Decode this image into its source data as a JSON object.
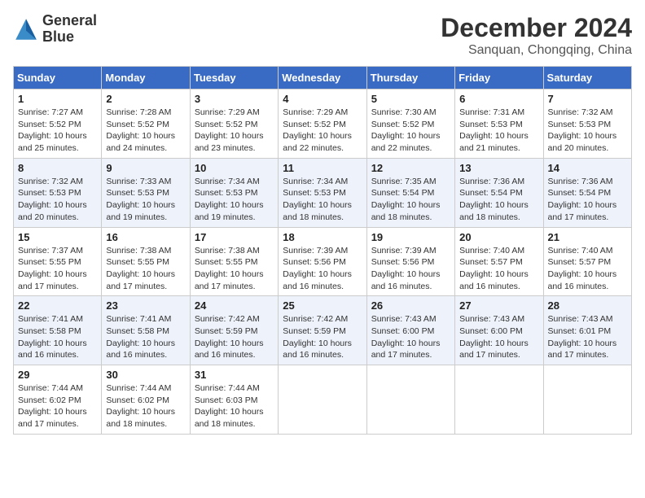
{
  "logo": {
    "line1": "General",
    "line2": "Blue"
  },
  "title": "December 2024",
  "location": "Sanquan, Chongqing, China",
  "weekdays": [
    "Sunday",
    "Monday",
    "Tuesday",
    "Wednesday",
    "Thursday",
    "Friday",
    "Saturday"
  ],
  "weeks": [
    [
      {
        "day": "1",
        "info": "Sunrise: 7:27 AM\nSunset: 5:52 PM\nDaylight: 10 hours\nand 25 minutes."
      },
      {
        "day": "2",
        "info": "Sunrise: 7:28 AM\nSunset: 5:52 PM\nDaylight: 10 hours\nand 24 minutes."
      },
      {
        "day": "3",
        "info": "Sunrise: 7:29 AM\nSunset: 5:52 PM\nDaylight: 10 hours\nand 23 minutes."
      },
      {
        "day": "4",
        "info": "Sunrise: 7:29 AM\nSunset: 5:52 PM\nDaylight: 10 hours\nand 22 minutes."
      },
      {
        "day": "5",
        "info": "Sunrise: 7:30 AM\nSunset: 5:52 PM\nDaylight: 10 hours\nand 22 minutes."
      },
      {
        "day": "6",
        "info": "Sunrise: 7:31 AM\nSunset: 5:53 PM\nDaylight: 10 hours\nand 21 minutes."
      },
      {
        "day": "7",
        "info": "Sunrise: 7:32 AM\nSunset: 5:53 PM\nDaylight: 10 hours\nand 20 minutes."
      }
    ],
    [
      {
        "day": "8",
        "info": "Sunrise: 7:32 AM\nSunset: 5:53 PM\nDaylight: 10 hours\nand 20 minutes."
      },
      {
        "day": "9",
        "info": "Sunrise: 7:33 AM\nSunset: 5:53 PM\nDaylight: 10 hours\nand 19 minutes."
      },
      {
        "day": "10",
        "info": "Sunrise: 7:34 AM\nSunset: 5:53 PM\nDaylight: 10 hours\nand 19 minutes."
      },
      {
        "day": "11",
        "info": "Sunrise: 7:34 AM\nSunset: 5:53 PM\nDaylight: 10 hours\nand 18 minutes."
      },
      {
        "day": "12",
        "info": "Sunrise: 7:35 AM\nSunset: 5:54 PM\nDaylight: 10 hours\nand 18 minutes."
      },
      {
        "day": "13",
        "info": "Sunrise: 7:36 AM\nSunset: 5:54 PM\nDaylight: 10 hours\nand 18 minutes."
      },
      {
        "day": "14",
        "info": "Sunrise: 7:36 AM\nSunset: 5:54 PM\nDaylight: 10 hours\nand 17 minutes."
      }
    ],
    [
      {
        "day": "15",
        "info": "Sunrise: 7:37 AM\nSunset: 5:55 PM\nDaylight: 10 hours\nand 17 minutes."
      },
      {
        "day": "16",
        "info": "Sunrise: 7:38 AM\nSunset: 5:55 PM\nDaylight: 10 hours\nand 17 minutes."
      },
      {
        "day": "17",
        "info": "Sunrise: 7:38 AM\nSunset: 5:55 PM\nDaylight: 10 hours\nand 17 minutes."
      },
      {
        "day": "18",
        "info": "Sunrise: 7:39 AM\nSunset: 5:56 PM\nDaylight: 10 hours\nand 16 minutes."
      },
      {
        "day": "19",
        "info": "Sunrise: 7:39 AM\nSunset: 5:56 PM\nDaylight: 10 hours\nand 16 minutes."
      },
      {
        "day": "20",
        "info": "Sunrise: 7:40 AM\nSunset: 5:57 PM\nDaylight: 10 hours\nand 16 minutes."
      },
      {
        "day": "21",
        "info": "Sunrise: 7:40 AM\nSunset: 5:57 PM\nDaylight: 10 hours\nand 16 minutes."
      }
    ],
    [
      {
        "day": "22",
        "info": "Sunrise: 7:41 AM\nSunset: 5:58 PM\nDaylight: 10 hours\nand 16 minutes."
      },
      {
        "day": "23",
        "info": "Sunrise: 7:41 AM\nSunset: 5:58 PM\nDaylight: 10 hours\nand 16 minutes."
      },
      {
        "day": "24",
        "info": "Sunrise: 7:42 AM\nSunset: 5:59 PM\nDaylight: 10 hours\nand 16 minutes."
      },
      {
        "day": "25",
        "info": "Sunrise: 7:42 AM\nSunset: 5:59 PM\nDaylight: 10 hours\nand 16 minutes."
      },
      {
        "day": "26",
        "info": "Sunrise: 7:43 AM\nSunset: 6:00 PM\nDaylight: 10 hours\nand 17 minutes."
      },
      {
        "day": "27",
        "info": "Sunrise: 7:43 AM\nSunset: 6:00 PM\nDaylight: 10 hours\nand 17 minutes."
      },
      {
        "day": "28",
        "info": "Sunrise: 7:43 AM\nSunset: 6:01 PM\nDaylight: 10 hours\nand 17 minutes."
      }
    ],
    [
      {
        "day": "29",
        "info": "Sunrise: 7:44 AM\nSunset: 6:02 PM\nDaylight: 10 hours\nand 17 minutes."
      },
      {
        "day": "30",
        "info": "Sunrise: 7:44 AM\nSunset: 6:02 PM\nDaylight: 10 hours\nand 18 minutes."
      },
      {
        "day": "31",
        "info": "Sunrise: 7:44 AM\nSunset: 6:03 PM\nDaylight: 10 hours\nand 18 minutes."
      },
      null,
      null,
      null,
      null
    ]
  ]
}
